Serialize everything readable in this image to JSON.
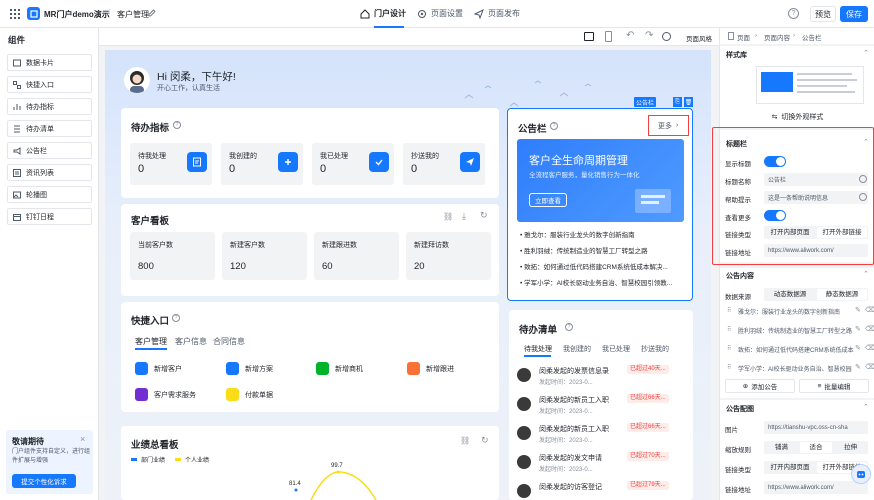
{
  "header": {
    "app_title": "MR门户demo演示",
    "crumb": "客户管理",
    "tabs": [
      "门户设计",
      "页面设置",
      "页面发布"
    ],
    "preview": "预览",
    "save": "保存",
    "style_label": "页面风格"
  },
  "left": {
    "title": "组件",
    "items": [
      "数据卡片",
      "快捷入口",
      "待办指标",
      "待办清单",
      "公告栏",
      "资讯列表",
      "轮播图",
      "钉钉日程"
    ],
    "promo_title": "敬请期待",
    "promo_text": "门户组件支持自定义，进行组件扩展与增强",
    "promo_button": "提交个性化诉求"
  },
  "greeting": {
    "title": "Hi 闵柔，下午好!",
    "subtitle": "开心工作，认真生活"
  },
  "todo_metrics": {
    "title": "待办指标",
    "items": [
      {
        "label": "待我处理",
        "value": "0"
      },
      {
        "label": "我创建的",
        "value": "0"
      },
      {
        "label": "我已处理",
        "value": "0"
      },
      {
        "label": "抄送我的",
        "value": "0"
      }
    ]
  },
  "customer_board": {
    "title": "客户看板",
    "items": [
      {
        "label": "当前客户数",
        "value": "800"
      },
      {
        "label": "新建客户数",
        "value": "120"
      },
      {
        "label": "新建跟进数",
        "value": "60"
      },
      {
        "label": "新建拜访数",
        "value": "20"
      }
    ]
  },
  "quick": {
    "title": "快捷入口",
    "tabs": [
      "客户管理",
      "客户信息",
      "合同信息"
    ],
    "items": [
      "新增客户",
      "新增方案",
      "新增商机",
      "新增跟进",
      "客户需求服务",
      "付款单据"
    ]
  },
  "perf": {
    "title": "业绩总看板",
    "legend": [
      "部门业绩",
      "个人业绩"
    ],
    "labels": [
      "99.7",
      "81.4"
    ]
  },
  "notice": {
    "tag": "公告栏",
    "title": "公告栏",
    "more": "更多",
    "banner_title": "客户全生命周期管理",
    "banner_sub": "全流程客户服务，量化销售行为一体化",
    "banner_btn": "立即查看",
    "items": [
      "雅戈尔：服装行业龙头的数字创新指南",
      "胜利羽绒：传统制造业的智慧工厂转型之路",
      "致拓：如何通过低代码搭建CRM系统低成本解决...",
      "学军小学：AI校长驱动业务自治、智慧校园引领教..."
    ]
  },
  "todo_list": {
    "title": "待办清单",
    "tabs": [
      "待我处理",
      "我创建的",
      "我已处理",
      "抄送我的"
    ],
    "items": [
      {
        "title": "闵柔发起的发票信息录",
        "time": "发起时间：2023-0...",
        "badge": "已超过40天..."
      },
      {
        "title": "闵柔发起的新员工入职",
        "time": "发起时间：2023-0...",
        "badge": "已超过66天..."
      },
      {
        "title": "闵柔发起的新员工入职",
        "time": "发起时间：2023-0...",
        "badge": "已超过66天..."
      },
      {
        "title": "闵柔发起的发文申请",
        "time": "发起时间：2023-0...",
        "badge": "已超过70天..."
      },
      {
        "title": "闵柔发起的访客登记",
        "time": "",
        "badge": "已超过79天..."
      }
    ]
  },
  "panel": {
    "breadcrumb": [
      "页面",
      "页面内容",
      "公告栏"
    ],
    "style_lib": "样式库",
    "switch_style": "切换外观样式",
    "title_section": "标题栏",
    "show_title": "显示标题",
    "title_name_label": "标题名称",
    "title_name_value": "公告栏",
    "help_label": "帮助提示",
    "help_value": "这是一条帮助说明信息",
    "more_label": "查看更多",
    "link_type_label": "链接类型",
    "link_type_options": [
      "打开内部页面",
      "打开外部链接"
    ],
    "link_addr_label": "链接地址",
    "link_addr_value": "https://www.aliwork.com/",
    "content_section": "公告内容",
    "source_label": "数据来源",
    "source_options": [
      "动态数据源",
      "静态数据源"
    ],
    "notices": [
      "雅戈尔：服装行业龙头的数字创新指南",
      "胜利羽绒：传统制造业的智慧工厂转型之路",
      "致拓：如何通过低代码搭建CRM系统低成本",
      "学军小学：AI校长驱动业务自治、智慧校园"
    ],
    "add_notice": "添加公告",
    "batch_edit": "批量编辑",
    "image_section": "公告配图",
    "image_label": "图片",
    "image_value": "https://tianshu-vpc.oss-cn-sha",
    "zoom_label": "缩放规则",
    "zoom_options": [
      "铺满",
      "适合",
      "拉伸"
    ],
    "link_type2_label": "链接类型",
    "link_type2_options": [
      "打开内部页面",
      "打开外部链接"
    ],
    "link_addr2_label": "链接地址",
    "link_addr2_value": "https://www.aliwork.com/"
  },
  "colors": {
    "primary": "#1677ff",
    "danger": "#f53f3f"
  }
}
